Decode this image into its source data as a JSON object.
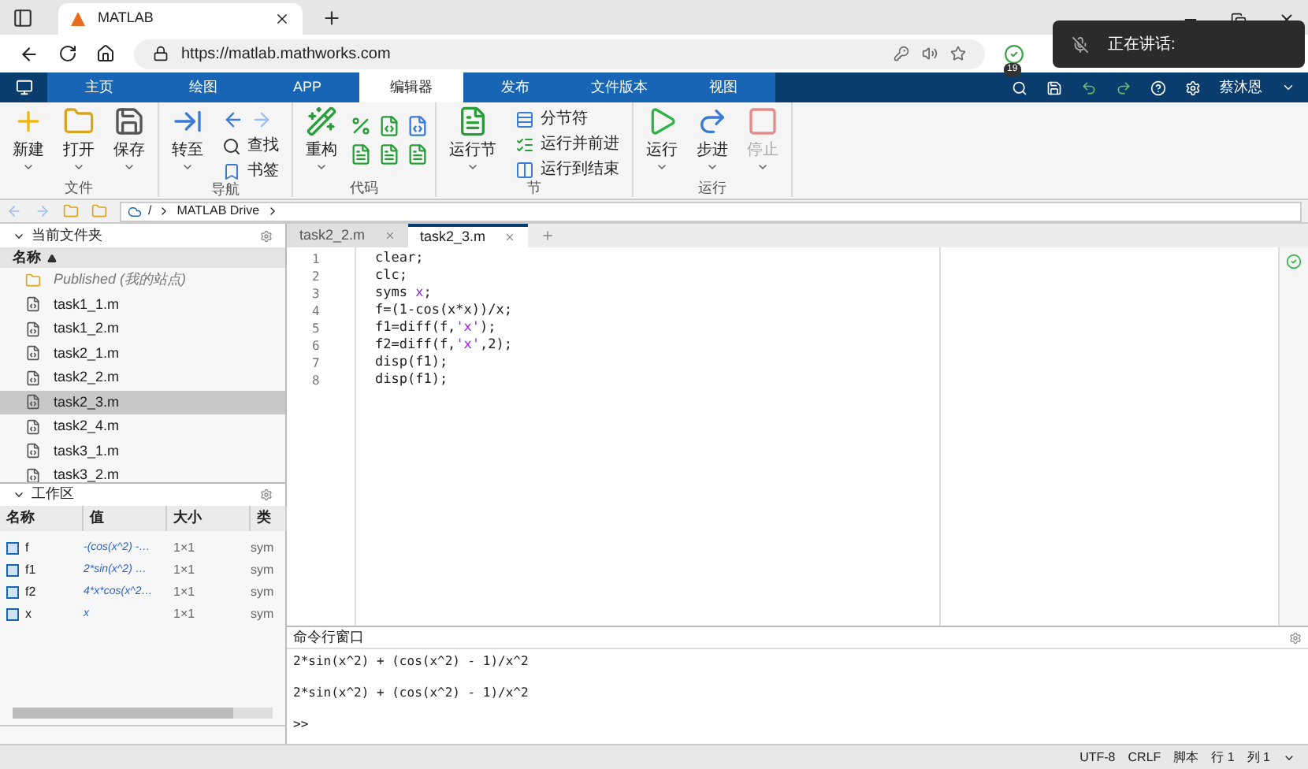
{
  "browser": {
    "tab_title": "MATLAB",
    "url": "https://matlab.mathworks.com",
    "extension_badge": "19"
  },
  "notification": {
    "text": "正在讲话:"
  },
  "app_tabs": [
    {
      "label": "主页",
      "selected": false
    },
    {
      "label": "绘图",
      "selected": false
    },
    {
      "label": "APP",
      "selected": false
    },
    {
      "label": "编辑器",
      "selected": true
    },
    {
      "label": "发布",
      "selected": false
    },
    {
      "label": "文件版本",
      "selected": false
    },
    {
      "label": "视图",
      "selected": false
    }
  ],
  "user": {
    "name": "蔡沐恩"
  },
  "ribbon_groups": [
    {
      "label": "文件",
      "buttons": [
        {
          "kind": "large",
          "label": "新建",
          "disabled": false
        },
        {
          "kind": "large",
          "label": "打开",
          "disabled": false
        },
        {
          "kind": "large",
          "label": "保存",
          "disabled": false
        }
      ]
    },
    {
      "label": "导航",
      "buttons": [
        {
          "kind": "large",
          "label": "转至",
          "disabled": false
        },
        {
          "kind": "arrows"
        },
        {
          "kind": "small",
          "label": "查找",
          "disabled": false
        },
        {
          "kind": "small",
          "label": "书签",
          "disabled": false
        }
      ]
    },
    {
      "label": "代码",
      "buttons": [
        {
          "kind": "large",
          "label": "重构",
          "disabled": false
        },
        {
          "kind": "grid"
        }
      ]
    },
    {
      "label": "节",
      "buttons": [
        {
          "kind": "large",
          "label": "运行节",
          "disabled": false
        },
        {
          "kind": "small",
          "label": "分节符",
          "disabled": false
        },
        {
          "kind": "small",
          "label": "运行并前进",
          "disabled": false
        },
        {
          "kind": "small",
          "label": "运行到结束",
          "disabled": false
        }
      ]
    },
    {
      "label": "运行",
      "buttons": [
        {
          "kind": "large",
          "label": "运行",
          "disabled": false
        },
        {
          "kind": "large",
          "label": "步进",
          "disabled": false
        },
        {
          "kind": "large",
          "label": "停止",
          "disabled": true
        }
      ]
    }
  ],
  "path": [
    "/",
    "MATLAB Drive"
  ],
  "current_folder": {
    "title": "当前文件夹",
    "column": "名称",
    "items": [
      {
        "kind": "folder",
        "name": "Published (我的站点)",
        "selected": false
      },
      {
        "kind": "file",
        "name": "task1_1.m",
        "selected": false
      },
      {
        "kind": "file",
        "name": "task1_2.m",
        "selected": false
      },
      {
        "kind": "file",
        "name": "task2_1.m",
        "selected": false
      },
      {
        "kind": "file",
        "name": "task2_2.m",
        "selected": false
      },
      {
        "kind": "file",
        "name": "task2_3.m",
        "selected": true
      },
      {
        "kind": "file",
        "name": "task2_4.m",
        "selected": false
      },
      {
        "kind": "file",
        "name": "task3_1.m",
        "selected": false
      },
      {
        "kind": "file",
        "name": "task3_2.m",
        "selected": false
      }
    ]
  },
  "workspace": {
    "title": "工作区",
    "columns": [
      "名称",
      "值",
      "大小",
      "类"
    ],
    "rows": [
      {
        "name": "f",
        "value": "-(cos(x^2) -…",
        "size": "1×1",
        "class": "sym"
      },
      {
        "name": "f1",
        "value": "2*sin(x^2) …",
        "size": "1×1",
        "class": "sym"
      },
      {
        "name": "f2",
        "value": "4*x*cos(x^2…",
        "size": "1×1",
        "class": "sym"
      },
      {
        "name": "x",
        "value": "x",
        "size": "1×1",
        "class": "sym"
      }
    ]
  },
  "editor": {
    "tabs": [
      {
        "label": "task2_2.m",
        "selected": false
      },
      {
        "label": "task2_3.m",
        "selected": true
      }
    ],
    "lines": [
      {
        "number": "1",
        "tokens": [
          {
            "kind": "code",
            "text": "clear;"
          }
        ]
      },
      {
        "number": "2",
        "tokens": [
          {
            "kind": "code",
            "text": "clc;"
          }
        ]
      },
      {
        "number": "3",
        "tokens": [
          {
            "kind": "code",
            "text": "syms "
          },
          {
            "kind": "string",
            "text": "x"
          },
          {
            "kind": "code",
            "text": ";"
          }
        ]
      },
      {
        "number": "4",
        "tokens": [
          {
            "kind": "code",
            "text": "f=(1-cos(x*x))/x;"
          }
        ]
      },
      {
        "number": "5",
        "tokens": [
          {
            "kind": "code",
            "text": "f1=diff(f,"
          },
          {
            "kind": "string",
            "text": "'x'"
          },
          {
            "kind": "code",
            "text": ");"
          }
        ]
      },
      {
        "number": "6",
        "tokens": [
          {
            "kind": "code",
            "text": "f2=diff(f,"
          },
          {
            "kind": "string",
            "text": "'x'"
          },
          {
            "kind": "code",
            "text": ",2);"
          }
        ]
      },
      {
        "number": "7",
        "tokens": [
          {
            "kind": "code",
            "text": "disp(f1);"
          }
        ]
      },
      {
        "number": "8",
        "tokens": [
          {
            "kind": "code",
            "text": "disp(f1);"
          }
        ]
      }
    ]
  },
  "command_window": {
    "title": "命令行窗口",
    "outputs": [
      "2*sin(x^2) + (cos(x^2) - 1)/x^2",
      "2*sin(x^2) + (cos(x^2) - 1)/x^2"
    ],
    "prompt": ">>"
  },
  "status_bar": [
    "UTF-8",
    "CRLF",
    "脚本",
    "行 1",
    "列 1"
  ]
}
